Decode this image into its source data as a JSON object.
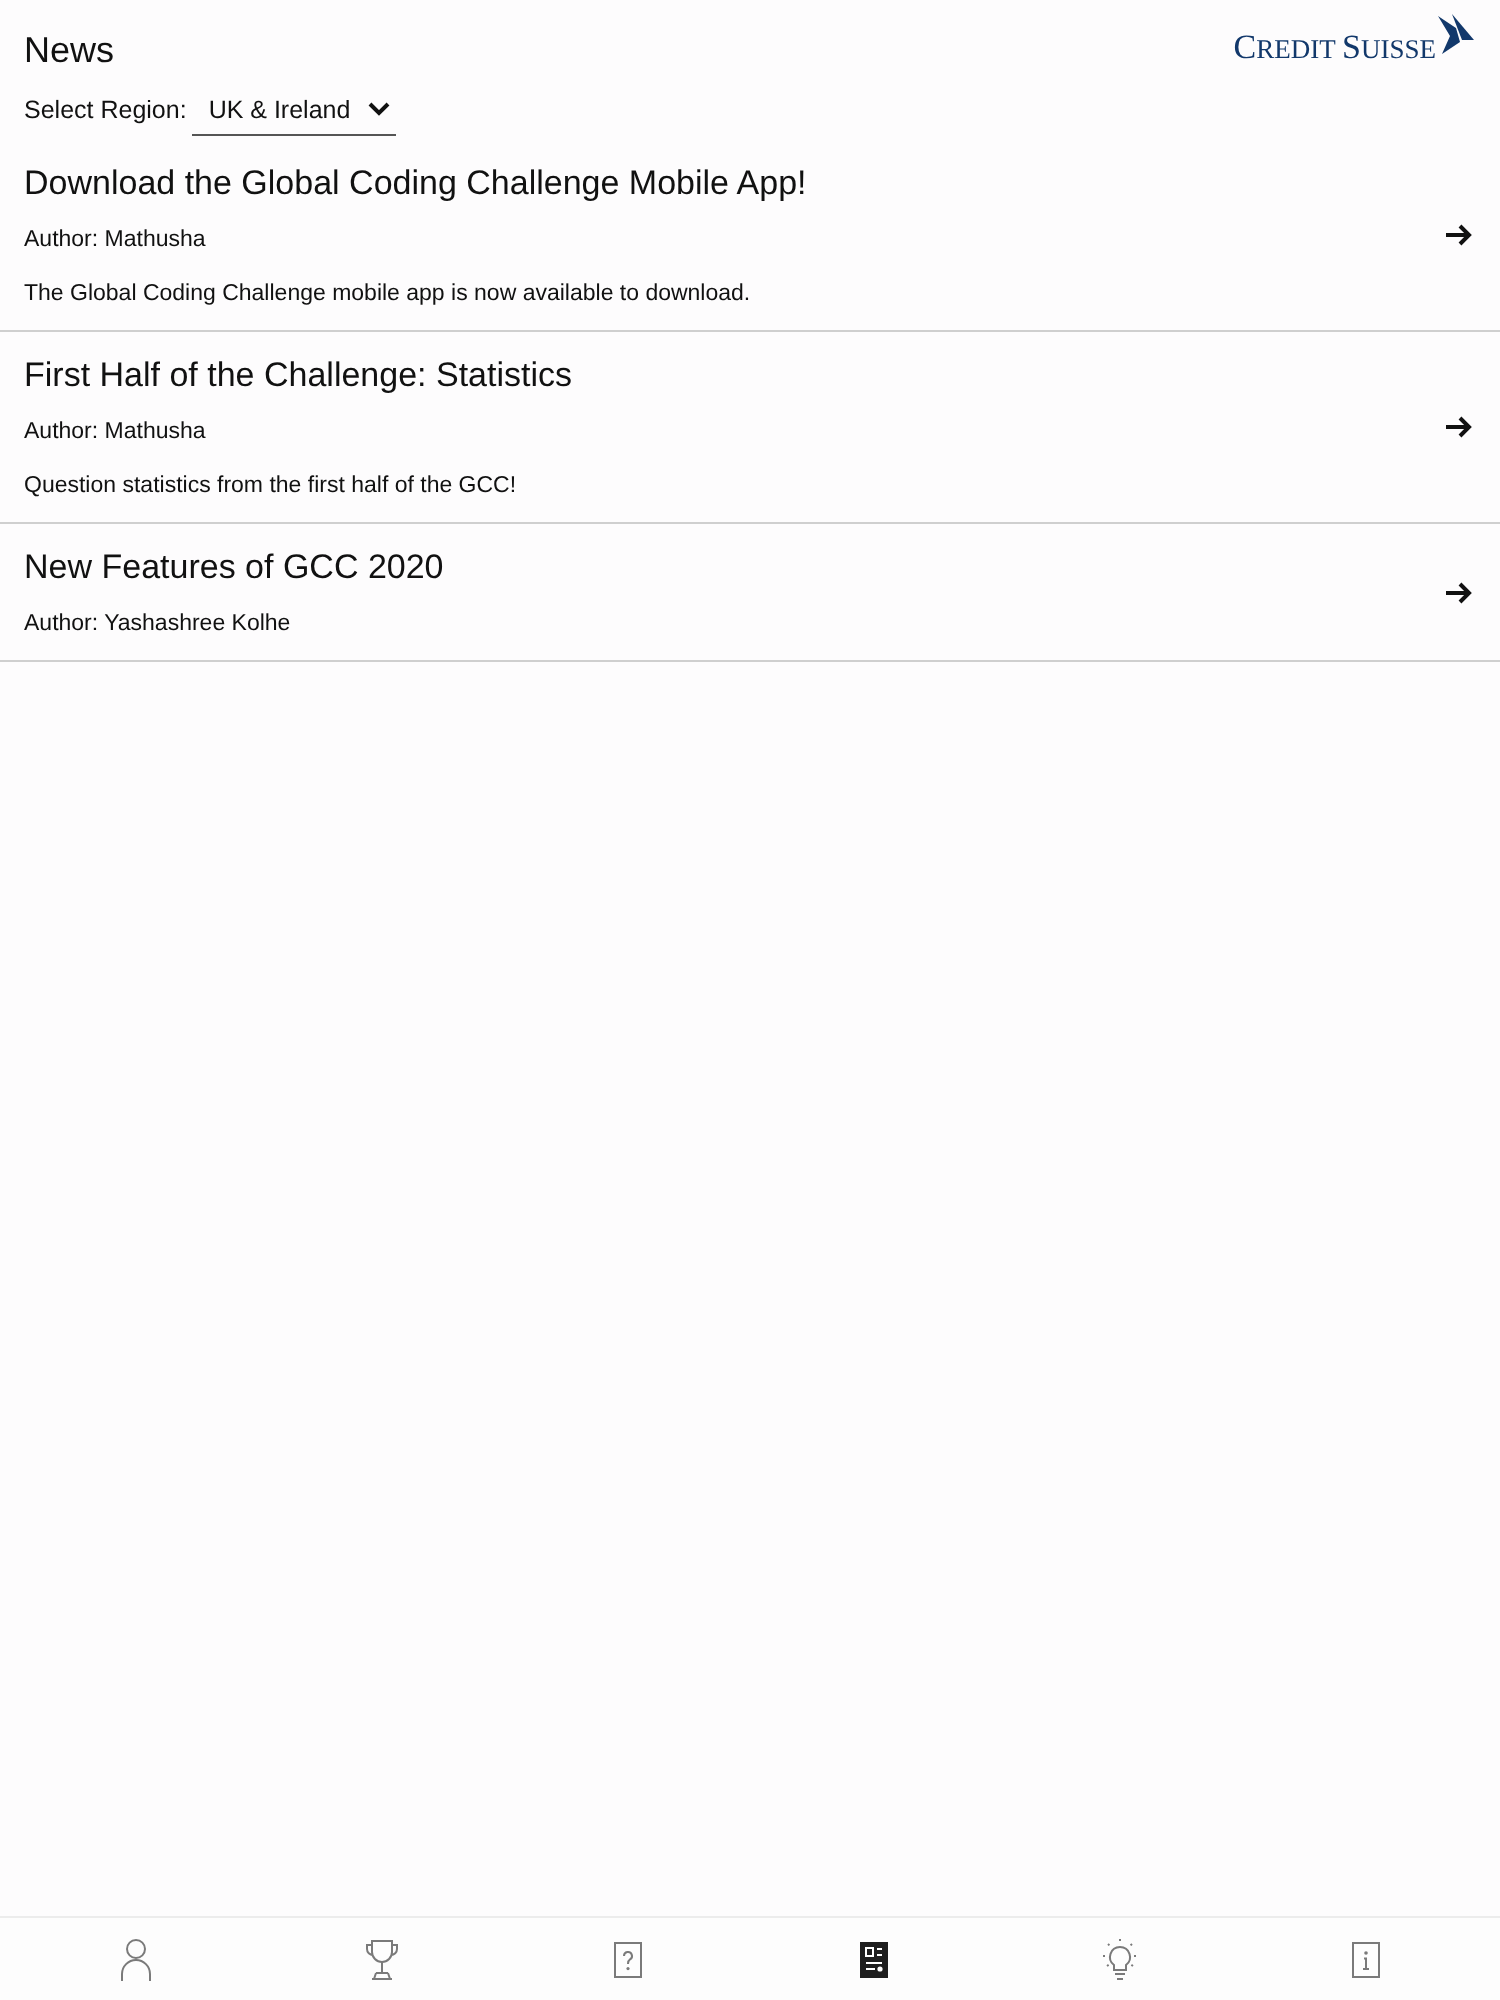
{
  "header": {
    "title": "News",
    "logo": "CREDIT SUISSE"
  },
  "region": {
    "label": "Select Region:",
    "value": "UK & Ireland"
  },
  "articles": [
    {
      "title": "Download the Global Coding Challenge Mobile App!",
      "author": "Author: Mathusha",
      "description": "The Global Coding Challenge mobile app is now available to download."
    },
    {
      "title": "First Half of the Challenge: Statistics",
      "author": "Author: Mathusha",
      "description": "Question statistics from the first half of the GCC!"
    },
    {
      "title": "New Features of GCC 2020",
      "author": "Author: Yashashree Kolhe"
    }
  ],
  "tabs": [
    {
      "kind": "profile",
      "selected": false
    },
    {
      "kind": "trophy",
      "selected": false
    },
    {
      "kind": "question",
      "selected": false
    },
    {
      "kind": "news",
      "selected": true
    },
    {
      "kind": "idea",
      "selected": false
    },
    {
      "kind": "info",
      "selected": false
    }
  ]
}
